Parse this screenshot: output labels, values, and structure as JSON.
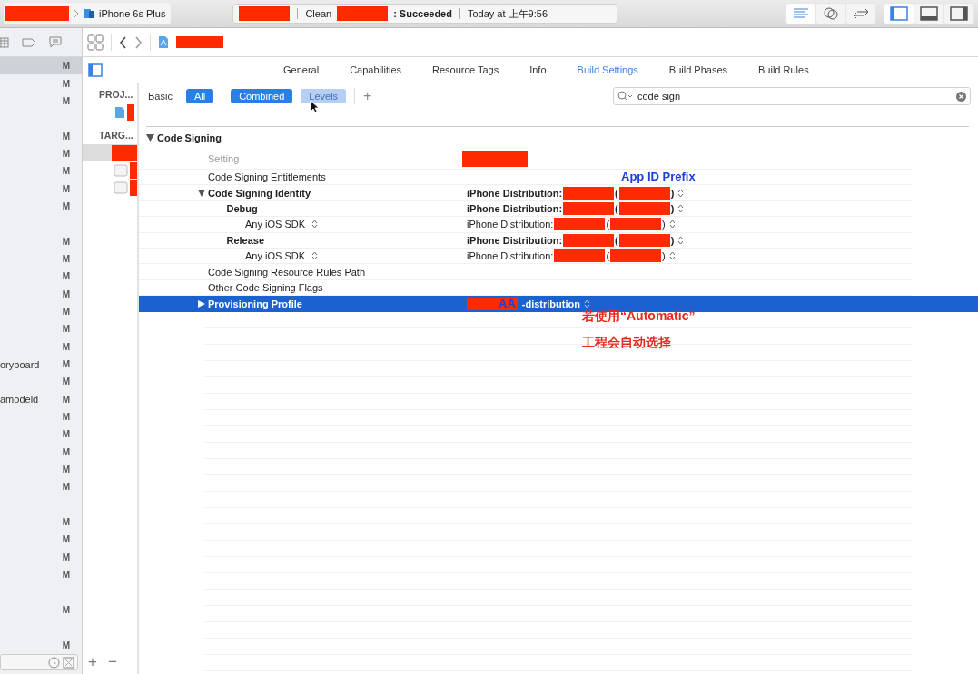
{
  "toolbar": {
    "scheme": {
      "redacted": true,
      "device": "iPhone 6s Plus"
    },
    "activity": [
      {
        "kind": "redaction"
      },
      {
        "kind": "separator"
      },
      {
        "kind": "text",
        "text": "Clean"
      },
      {
        "kind": "redaction"
      },
      {
        "kind": "bold",
        "text": ": Succeeded"
      },
      {
        "kind": "separator"
      },
      {
        "kind": "text",
        "text": "Today at 上午9:56"
      }
    ],
    "editor_modes": [
      {
        "selected": true
      },
      {
        "selected": false
      },
      {
        "selected": false
      }
    ],
    "panels": [
      {
        "selected": true
      },
      {
        "selected": false
      },
      {
        "selected": false
      }
    ]
  },
  "navigator": {
    "rows": [
      {
        "kind": "file",
        "status": "M",
        "selected": true
      },
      {
        "kind": "file",
        "status": "M",
        "selected": false
      },
      {
        "kind": "file",
        "status": "M",
        "selected": false
      },
      {
        "kind": "spacer"
      },
      {
        "kind": "file",
        "status": "M",
        "selected": false
      },
      {
        "kind": "file",
        "status": "M",
        "selected": false
      },
      {
        "kind": "file",
        "status": "M",
        "selected": false
      },
      {
        "kind": "file",
        "status": "M",
        "selected": false
      },
      {
        "kind": "file",
        "status": "M",
        "selected": false
      },
      {
        "kind": "spacer"
      },
      {
        "kind": "file",
        "status": "M",
        "selected": false
      },
      {
        "kind": "file",
        "status": "M",
        "selected": false
      },
      {
        "kind": "file",
        "status": "M",
        "selected": false
      },
      {
        "kind": "file",
        "status": "M",
        "selected": false
      },
      {
        "kind": "file",
        "status": "M",
        "selected": false
      },
      {
        "kind": "file",
        "status": "M",
        "selected": false
      },
      {
        "kind": "file",
        "status": "M",
        "selected": false
      },
      {
        "kind": "file",
        "text": "oryboard",
        "status": "M",
        "selected": false
      },
      {
        "kind": "file",
        "status": "M",
        "selected": false
      },
      {
        "kind": "file",
        "text": "amodeld",
        "status": "M",
        "selected": false
      },
      {
        "kind": "file",
        "status": "M",
        "selected": false
      },
      {
        "kind": "file",
        "status": "M",
        "selected": false
      },
      {
        "kind": "file",
        "status": "M",
        "selected": false
      },
      {
        "kind": "file",
        "status": "M",
        "selected": false
      },
      {
        "kind": "file",
        "status": "M",
        "selected": false
      },
      {
        "kind": "spacer"
      },
      {
        "kind": "file",
        "status": "M",
        "selected": false
      },
      {
        "kind": "file",
        "status": "M",
        "selected": false
      },
      {
        "kind": "file",
        "status": "M",
        "selected": false
      },
      {
        "kind": "file",
        "status": "M",
        "selected": false
      },
      {
        "kind": "spacer"
      },
      {
        "kind": "file",
        "status": "M",
        "selected": false
      },
      {
        "kind": "spacer"
      },
      {
        "kind": "file",
        "status": "M",
        "selected": false
      }
    ]
  },
  "jump_bar": {
    "file_redacted": true
  },
  "tabs": [
    {
      "label": "General",
      "selected": false
    },
    {
      "label": "Capabilities",
      "selected": false
    },
    {
      "label": "Resource Tags",
      "selected": false
    },
    {
      "label": "Info",
      "selected": false
    },
    {
      "label": "Build Settings",
      "selected": true
    },
    {
      "label": "Build Phases",
      "selected": false
    },
    {
      "label": "Build Rules",
      "selected": false
    }
  ],
  "targets": [
    {
      "kind": "header",
      "text": "PROJ..."
    },
    {
      "kind": "project",
      "selected": false
    },
    {
      "kind": "header",
      "text": "TARG..."
    },
    {
      "kind": "target",
      "selected": true
    },
    {
      "kind": "target",
      "selected": false
    },
    {
      "kind": "target",
      "selected": false
    }
  ],
  "filter_bar": {
    "basic": "Basic",
    "scopes": [
      {
        "label": "All",
        "selected": true
      }
    ],
    "views": [
      {
        "label": "Combined",
        "selected": true
      },
      {
        "label": "Levels",
        "selected": false,
        "hovered": true
      }
    ],
    "add": "+",
    "search": {
      "value": "code sign"
    }
  },
  "section": {
    "title": "Code Signing",
    "expanded": true,
    "header": {
      "setting": "Setting",
      "value_redacted": true
    },
    "rows": [
      {
        "name": "Code Signing Entitlements",
        "bold": false,
        "selected": false,
        "value": []
      },
      {
        "name": "Code Signing Identity",
        "bold": true,
        "expanded": true,
        "selected": false,
        "value": [
          {
            "kind": "text",
            "text": "iPhone Distribution:"
          },
          {
            "kind": "redaction"
          },
          {
            "kind": "text",
            "text": "("
          },
          {
            "kind": "redaction"
          },
          {
            "kind": "text",
            "text": ")"
          },
          {
            "kind": "popup"
          }
        ],
        "children": [
          {
            "name": "Debug",
            "bold": true,
            "selected": false,
            "value": [
              {
                "kind": "text",
                "text": "iPhone Distribution:"
              },
              {
                "kind": "redaction"
              },
              {
                "kind": "text",
                "text": "("
              },
              {
                "kind": "redaction"
              },
              {
                "kind": "text",
                "text": ")"
              },
              {
                "kind": "popup"
              }
            ],
            "children": [
              {
                "name": "Any iOS SDK",
                "bold": false,
                "popup": true,
                "selected": false,
                "value": [
                  {
                    "kind": "text",
                    "text": "iPhone Distribution:"
                  },
                  {
                    "kind": "redaction"
                  },
                  {
                    "kind": "text",
                    "text": "("
                  },
                  {
                    "kind": "redaction"
                  },
                  {
                    "kind": "text",
                    "text": ")"
                  },
                  {
                    "kind": "popup"
                  }
                ]
              }
            ]
          },
          {
            "name": "Release",
            "bold": true,
            "selected": false,
            "value": [
              {
                "kind": "text",
                "text": "iPhone Distribution:"
              },
              {
                "kind": "redaction"
              },
              {
                "kind": "text",
                "text": "("
              },
              {
                "kind": "redaction"
              },
              {
                "kind": "text",
                "text": ")"
              },
              {
                "kind": "popup"
              }
            ],
            "children": [
              {
                "name": "Any iOS SDK",
                "bold": false,
                "popup": true,
                "selected": false,
                "value": [
                  {
                    "kind": "text",
                    "text": "iPhone Distribution:"
                  },
                  {
                    "kind": "redaction"
                  },
                  {
                    "kind": "text",
                    "text": "("
                  },
                  {
                    "kind": "redaction"
                  },
                  {
                    "kind": "text",
                    "text": ")"
                  },
                  {
                    "kind": "popup"
                  }
                ]
              }
            ]
          }
        ]
      },
      {
        "name": "Code Signing Resource Rules Path",
        "bold": false,
        "selected": false,
        "value": []
      },
      {
        "name": "Other Code Signing Flags",
        "bold": false,
        "selected": false,
        "value": []
      },
      {
        "name": "Provisioning Profile",
        "bold": true,
        "expanded": false,
        "selected": true,
        "value": [
          {
            "kind": "redaction"
          },
          {
            "kind": "mark",
            "text": "AA"
          },
          {
            "kind": "text",
            "text": "-distribution"
          },
          {
            "kind": "popup"
          }
        ]
      }
    ]
  },
  "annotations": [
    {
      "kind": "blue",
      "text": "App ID Prefix"
    },
    {
      "kind": "red",
      "text": "若使用“Automatic”"
    },
    {
      "kind": "red",
      "text": "工程会自动选择"
    }
  ],
  "target_buttons": [
    "+",
    "−"
  ]
}
